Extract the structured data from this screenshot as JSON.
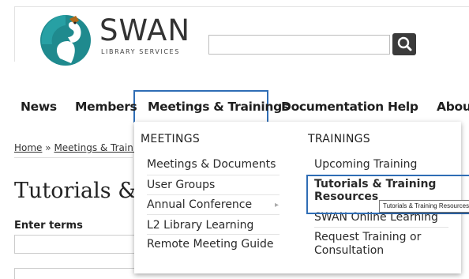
{
  "logo": {
    "name": "SWAN",
    "subtitle": "LIBRARY SERVICES"
  },
  "search": {
    "value": "",
    "placeholder": ""
  },
  "nav": {
    "items": [
      "News",
      "Members",
      "Meetings & Trainings",
      "Documentation",
      "Help",
      "About"
    ],
    "active": "Meetings & Trainings"
  },
  "breadcrumb": {
    "home": "Home",
    "separator": "»",
    "current": "Meetings & Trainin"
  },
  "page": {
    "title": "Tutorials & T",
    "enter_terms_label": "Enter terms"
  },
  "dropdown": {
    "meetings_heading": "MEETINGS",
    "meetings_items": [
      "Meetings & Documents",
      "User Groups",
      "Annual Conference",
      "L2 Library Learning",
      "Remote Meeting Guide"
    ],
    "trainings_heading": "TRAININGS",
    "trainings_items": [
      "Upcoming Training",
      "Tutorials & Training Resources",
      "SWAN Online Learning",
      "Request Training or Consultation"
    ],
    "tutorials_line1": "Tutorials & Training",
    "tutorials_line2": "Resources",
    "request_line1": "Request Training or",
    "request_line2": "Consultation"
  },
  "tooltip": "Tutorials & Training Resources",
  "colors": {
    "accent": "#2f6db5",
    "logo_teal": "#1f8a8e",
    "logo_dark": "#1f6e73"
  }
}
